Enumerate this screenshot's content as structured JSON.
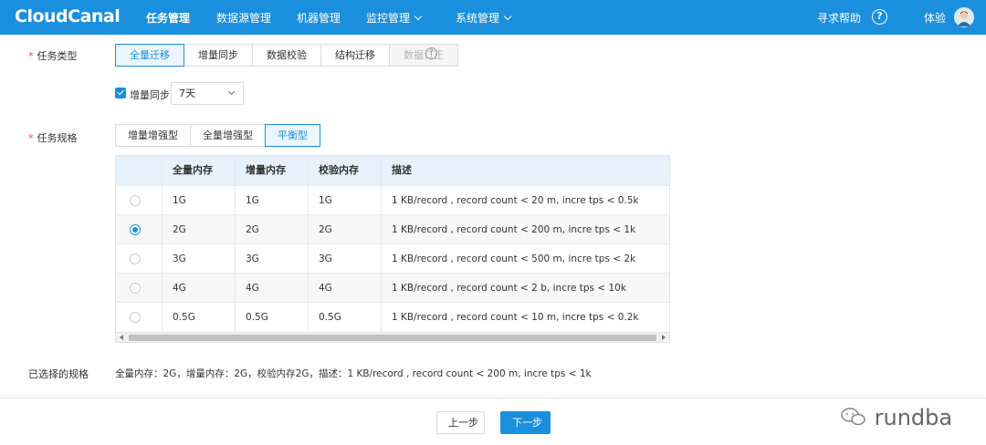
{
  "app": {
    "logo": "CloudCanal",
    "nav": [
      {
        "label": "任务管理",
        "active": true
      },
      {
        "label": "数据源管理",
        "active": false
      },
      {
        "label": "机器管理",
        "active": false
      },
      {
        "label": "监控管理",
        "active": false,
        "dropdown": true
      },
      {
        "label": "系统管理",
        "active": false,
        "dropdown": true
      }
    ],
    "help_label": "寻求帮助",
    "user_label": "体验",
    "accent": "#1a8fdd"
  },
  "form": {
    "task_type_label": "任务类型",
    "task_types": [
      {
        "label": "全量迁移",
        "state": "active"
      },
      {
        "label": "增量同步",
        "state": "normal"
      },
      {
        "label": "数据校验",
        "state": "normal"
      },
      {
        "label": "结构迁移",
        "state": "normal"
      },
      {
        "label": "数据订正",
        "state": "disabled"
      }
    ],
    "incremental_checkbox_label": "增量同步",
    "incremental_checked": true,
    "retention_value": "7天",
    "spec_label": "任务规格",
    "spec_types": [
      {
        "label": "增量增强型",
        "state": "normal"
      },
      {
        "label": "全量增强型",
        "state": "normal"
      },
      {
        "label": "平衡型",
        "state": "active"
      }
    ]
  },
  "spec_table": {
    "columns": [
      "全量内存",
      "增量内存",
      "校验内存",
      "描述"
    ],
    "rows": [
      {
        "full": "1G",
        "incr": "1G",
        "check": "1G",
        "desc": "1 KB/record , record count < 20 m, incre tps < 0.5k",
        "selected": false
      },
      {
        "full": "2G",
        "incr": "2G",
        "check": "2G",
        "desc": "1 KB/record , record count < 200 m, incre tps < 1k",
        "selected": true
      },
      {
        "full": "3G",
        "incr": "3G",
        "check": "3G",
        "desc": "1 KB/record , record count < 500 m, incre tps < 2k",
        "selected": false
      },
      {
        "full": "4G",
        "incr": "4G",
        "check": "4G",
        "desc": "1 KB/record , record count < 2 b, incre tps < 10k",
        "selected": false
      },
      {
        "full": "0.5G",
        "incr": "0.5G",
        "check": "0.5G",
        "desc": "1 KB/record , record count < 10 m, incre tps < 0.2k",
        "selected": false
      }
    ]
  },
  "selected_spec": {
    "label": "已选择的规格",
    "text": "全量内存：2G，增量内存：2G，校验内存2G，描述：1 KB/record , record count < 200 m, incre tps < 1k"
  },
  "footer": {
    "prev_label": "上一步",
    "next_label": "下一步",
    "watermark": "rundba"
  }
}
